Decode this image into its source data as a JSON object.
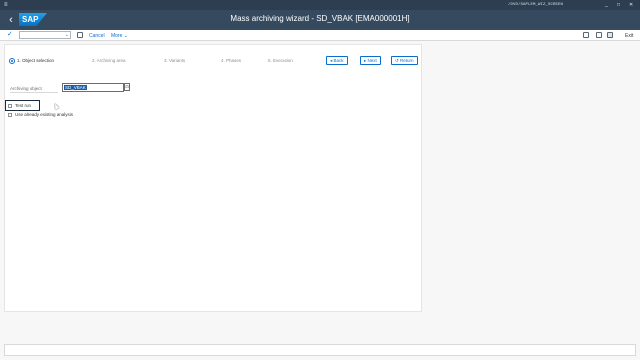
{
  "system": {
    "menu_glyph": "≡",
    "path": "/DVD/SAPLEM_WIZ_SCREEN",
    "controls": [
      "_",
      "□",
      "✕"
    ]
  },
  "header": {
    "back_glyph": "‹",
    "logo_text": "SAP",
    "title": "Mass archiving wizard - SD_VBAK [EMA000001H]"
  },
  "toolbar": {
    "confirm_glyph": "✓",
    "command_value": "",
    "cancel_label": "Cancel",
    "more_label": "More",
    "more_chevron": "⌄",
    "exit_label": "Exit"
  },
  "steps": [
    {
      "label": "1. Object selection",
      "active": true
    },
    {
      "label": "2. Archiving area",
      "active": false
    },
    {
      "label": "3. Variants",
      "active": false
    },
    {
      "label": "4. Phases",
      "active": false
    },
    {
      "label": "5. Execution",
      "active": false
    }
  ],
  "nav": {
    "back_label": "◂ Back",
    "next_label": "▸ Next",
    "return_label": "↺ Return"
  },
  "form": {
    "archiving_object_label": "Archiving object",
    "archiving_object_value": "SD_VBAK",
    "f4_glyph": "⊡",
    "test_run_label": "Test run",
    "existing_analysis_label": "Use already existing analysis"
  },
  "status": {
    "message": ""
  },
  "colors": {
    "shell": "#354a5f",
    "system_bar": "#2c3e50",
    "accent": "#0a6ed1",
    "selection": "#1a5ca8"
  }
}
